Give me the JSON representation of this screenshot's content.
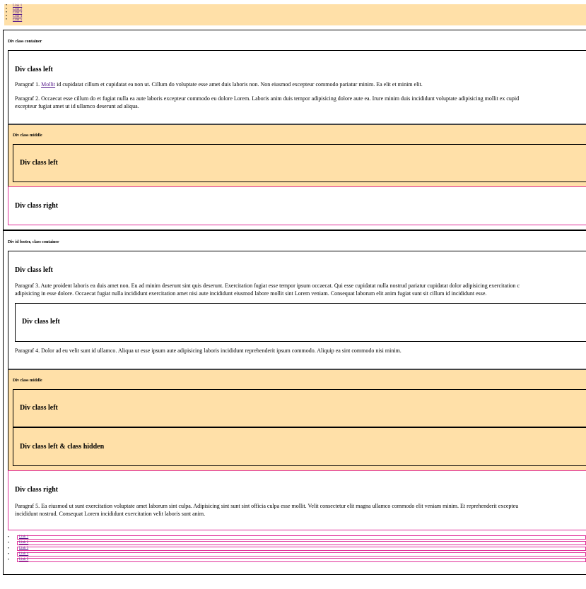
{
  "top_links": [
    "Link 1",
    "Link 2",
    "Link 3",
    "Link 4",
    "Link 5"
  ],
  "container1": {
    "caption": "Div class container",
    "left": {
      "heading": "Div class left",
      "p1_prefix": "Paragraf 1. ",
      "p1_link": "Mollit",
      "p1_rest": " id cupidatat cillum et cupidatat ea non ut. Cillum do voluptate esse amet duis laboris non. Non eiusmod excepteur commodo pariatur minim. Ea elit et minim elit.",
      "p2_line1": "Paragraf 2. Occaecat esse cillum do et fugiat nulla ea aute laboris excepteur commodo eu dolore Lorem. Laboris anim duis tempor adipisicing dolore aute ea. Irure minim duis incididunt voluptate adipisicing mollit ex cupid",
      "p2_line2": "excepteur fugiat amet ut id ullamco deserunt ad aliqua."
    },
    "middle": {
      "caption": "Div class middle",
      "left_heading": "Div class left"
    },
    "right": {
      "heading": "Div class right"
    }
  },
  "container2": {
    "caption": "Div id footer, class container",
    "left": {
      "heading": "Div class left",
      "p3_line1": "Paragraf 3. Aute proident laboris ea duis amet non. Eu ad minim deserunt sint quis deserunt. Exercitation fugiat esse tempor ipsum occaecat. Qui esse cupidatat nulla nostrud pariatur cupidatat dolor adipisicing exercitation c",
      "p3_line2": "adipisicing in esse dolore. Occaecat fugiat nulla incididunt exercitation amet nisi aute incididunt eiusmod labore mollit sint Lorem veniam. Consequat laborum elit anim fugiat sunt sit cillum id incididunt esse.",
      "inner_heading": "Div class left",
      "p4": "Paragraf 4. Dolor ad eu velit sunt id ullamco. Aliqua ut esse ipsum aute adipisicing laboris incididunt reprehenderit ipsum commodo. Aliquip ea sint commodo nisi minim."
    },
    "middle": {
      "caption": "Div class middle",
      "left_heading": "Div class left",
      "hidden_heading": "Div class left & class hidden"
    },
    "right": {
      "heading": "Div class right",
      "p5_line1": "Paragraf 5. Ea eiusmod ut sunt exercitation voluptate amet laborum sint culpa. Adipisicing sint sunt sint officia culpa esse mollit. Velit consectetur elit magna ullamco commodo elit veniam minim. Et reprehenderit excepteu",
      "p5_line2": "incididunt nostrud. Consequat Lorem incididunt exercitation velit laboris sunt anim."
    }
  },
  "bottom_links": [
    "Link 1",
    "Link 2",
    "Link 3",
    "Link 4",
    "Link 5"
  ],
  "colors": {
    "sand": "#ffe0a8",
    "pink": "#e0309a",
    "link": "#551a8b"
  }
}
